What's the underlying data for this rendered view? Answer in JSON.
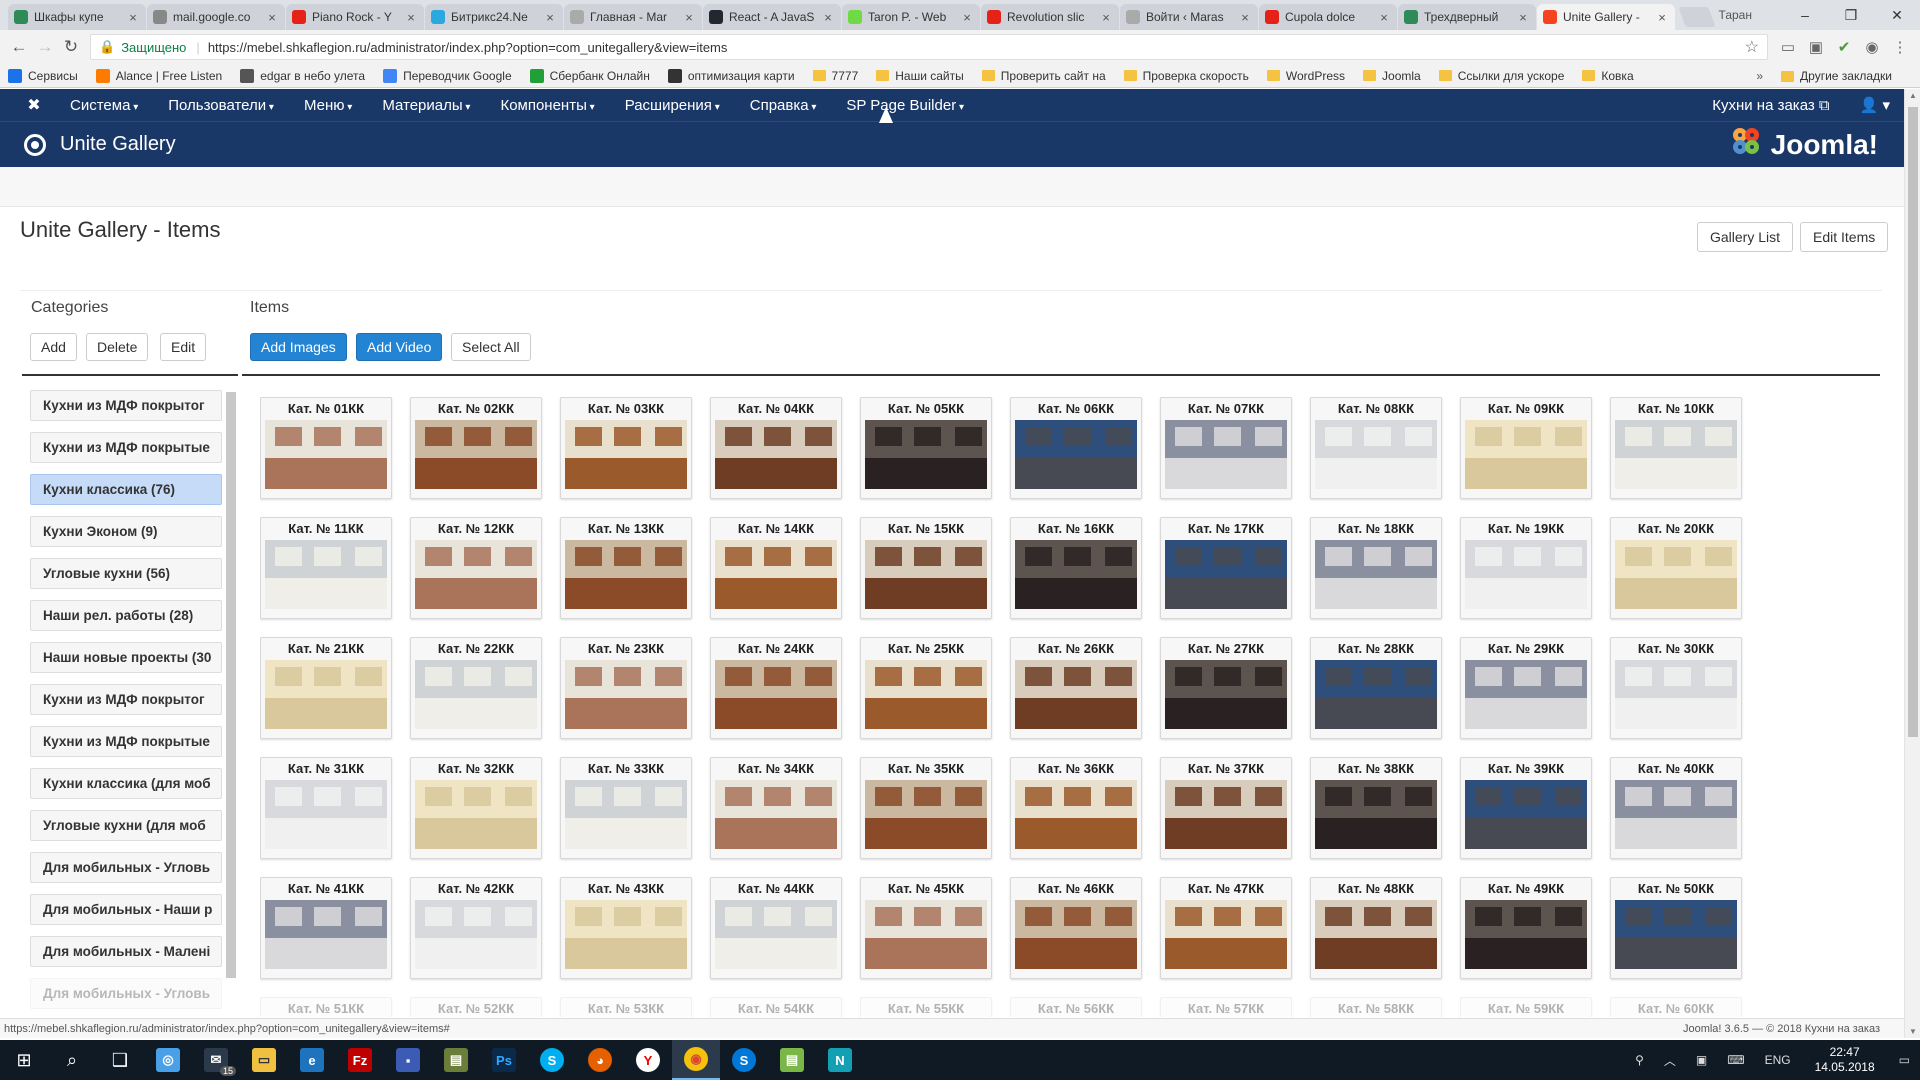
{
  "browser": {
    "tabs": [
      {
        "title": "Шкафы купе",
        "color": "#2e8b57"
      },
      {
        "title": "mail.google.co",
        "color": "#888888"
      },
      {
        "title": "Piano Rock - Y",
        "color": "#e62117"
      },
      {
        "title": "Битрикс24.Ne",
        "color": "#29a9e0"
      },
      {
        "title": "Главная - Mar",
        "color": "#aaaaaa"
      },
      {
        "title": "React - A JavaS",
        "color": "#23272f"
      },
      {
        "title": "Taron P. - Web",
        "color": "#6fda44"
      },
      {
        "title": "Revolution slic",
        "color": "#e62117"
      },
      {
        "title": "Войти ‹ Maras",
        "color": "#aaaaaa"
      },
      {
        "title": "Cupola dolce",
        "color": "#e62117"
      },
      {
        "title": "Трехдверный",
        "color": "#2e8b57"
      },
      {
        "title": "Unite Gallery -",
        "color": "#f44321"
      }
    ],
    "active_tab": 11,
    "profile_name": "Таран",
    "secure_label": "Защищено",
    "url": "https://mebel.shkaflegion.ru/administrator/index.php?option=com_unitegallery&view=items",
    "bookmarks": [
      {
        "label": "Сервисы",
        "type": "apps",
        "color": "#1a73e8"
      },
      {
        "label": "Alance | Free Listen",
        "type": "icon",
        "color": "#ff7b00"
      },
      {
        "label": "edgar в небо улета",
        "type": "icon",
        "color": "#555555"
      },
      {
        "label": "Переводчик Google",
        "type": "icon",
        "color": "#4285f4"
      },
      {
        "label": "Сбербанк Онлайн",
        "type": "icon",
        "color": "#21a038"
      },
      {
        "label": "оптимизация карти",
        "type": "icon",
        "color": "#333333"
      },
      {
        "label": "7777",
        "type": "folder"
      },
      {
        "label": "Наши сайты",
        "type": "folder"
      },
      {
        "label": "Проверить сайт на",
        "type": "folder"
      },
      {
        "label": "Проверка скорость",
        "type": "folder"
      },
      {
        "label": "WordPress",
        "type": "folder"
      },
      {
        "label": "Joomla",
        "type": "folder"
      },
      {
        "label": "Ссылки для ускоре",
        "type": "folder"
      },
      {
        "label": "Ковка",
        "type": "folder"
      }
    ],
    "other_bookmarks": "Другие закладки",
    "status_url": "https://mebel.shkaflegion.ru/administrator/index.php?option=com_unitegallery&view=items#"
  },
  "joomla": {
    "menu": [
      "Система",
      "Пользователи",
      "Меню",
      "Материалы",
      "Компоненты",
      "Расширения",
      "Справка",
      "SP Page Builder"
    ],
    "site_link": "Кухни на заказ ⧉",
    "user_icon": "user-icon",
    "component_title": "Unite Gallery",
    "brand": "Joomla!",
    "version": "Joomla! 3.6.5 — © 2018 Кухни на заказ"
  },
  "page": {
    "title": "Unite Gallery - Items",
    "gallery_list": "Gallery List",
    "edit_items": "Edit Items"
  },
  "categories": {
    "heading": "Categories",
    "add": "Add",
    "delete": "Delete",
    "edit": "Edit",
    "items": [
      "Кухни из МДФ покрытог",
      "Кухни из МДФ покрытые",
      "Кухни классика (76)",
      "Кухни Эконом (9)",
      "Угловые кухни (56)",
      "Наши рел. работы (28)",
      "Наши новые проекты (30",
      "Кухни из МДФ покрытог",
      "Кухни из МДФ покрытые",
      "Кухни классика (для моб",
      "Угловые кухни (для моб",
      "Для мобильных - Угловь",
      "Для мобильных - Наши р",
      "Для мобильных - Малені",
      "Для мобильных - Угловь"
    ],
    "selected": 2
  },
  "items": {
    "heading": "Items",
    "add_images": "Add Images",
    "add_video": "Add Video",
    "select_all": "Select All",
    "list": [
      "Кат. № 01КК",
      "Кат. № 02КК",
      "Кат. № 03КК",
      "Кат. № 04КК",
      "Кат. № 05КК",
      "Кат. № 06КК",
      "Кат. № 07КК",
      "Кат. № 08КК",
      "Кат. № 09КК",
      "Кат. № 10КК",
      "Кат. № 11КК",
      "Кат. № 12КК",
      "Кат. № 13КК",
      "Кат. № 14КК",
      "Кат. № 15КК",
      "Кат. № 16КК",
      "Кат. № 17КК",
      "Кат. № 18КК",
      "Кат. № 19КК",
      "Кат. № 20КК",
      "Кат. № 21КК",
      "Кат. № 22КК",
      "Кат. № 23КК",
      "Кат. № 24КК",
      "Кат. № 25КК",
      "Кат. № 26КК",
      "Кат. № 27КК",
      "Кат. № 28КК",
      "Кат. № 29КК",
      "Кат. № 30КК",
      "Кат. № 31КК",
      "Кат. № 32КК",
      "Кат. № 33КК",
      "Кат. № 34КК",
      "Кат. № 35КК",
      "Кат. № 36КК",
      "Кат. № 37КК",
      "Кат. № 38КК",
      "Кат. № 39КК",
      "Кат. № 40КК",
      "Кат. № 41КК",
      "Кат. № 42КК",
      "Кат. № 43КК",
      "Кат. № 44КК",
      "Кат. № 45КК",
      "Кат. № 46КК",
      "Кат. № 47КК",
      "Кат. № 48КК",
      "Кат. № 49КК",
      "Кат. № 50КК",
      "Кат. № 51КК",
      "Кат. № 52КК",
      "Кат. № 53КК",
      "Кат. № 54КК",
      "Кат. № 55КК",
      "Кат. № 56КК",
      "Кат. № 57КК",
      "Кат. № 58КК",
      "Кат. № 59КК",
      "Кат. № 60КК"
    ],
    "palette": [
      [
        "#e9e4da",
        "#a9745a"
      ],
      [
        "#d8cdbd",
        "#6e3d24"
      ],
      [
        "#8a90a0",
        "#d9d9dc"
      ],
      [
        "#cfd3d6",
        "#f0eee8"
      ],
      [
        "#e8dfcc",
        "#9b5a2b"
      ],
      [
        "#2e4f7c",
        "#474a52"
      ],
      [
        "#efe4c4",
        "#d8c89b"
      ],
      [
        "#cbb8a0",
        "#8b4a28"
      ],
      [
        "#5d5450",
        "#2a2222"
      ],
      [
        "#d7d9dc",
        "#f0f0f0"
      ]
    ]
  },
  "taskbar": {
    "lang": "ENG",
    "time": "22:47",
    "date": "14.05.2018",
    "mail_badge": "15"
  }
}
